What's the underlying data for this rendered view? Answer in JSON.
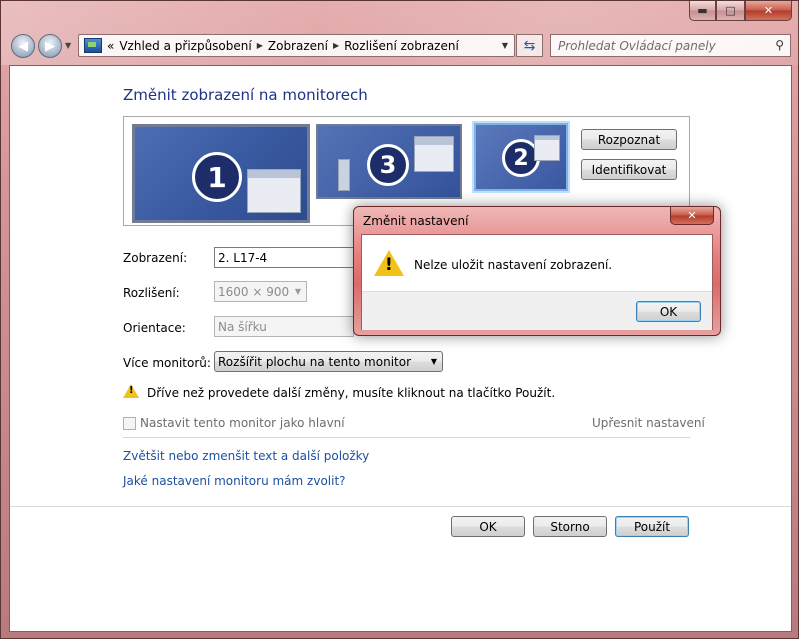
{
  "window": {
    "caption_buttons": {
      "minimize": "▬",
      "maximize": "□",
      "close": "✕"
    }
  },
  "nav": {
    "back_icon": "back-arrow-icon",
    "forward_icon": "forward-arrow-icon",
    "address": {
      "prefix": "«",
      "segments": [
        "Vzhled a přizpůsobení",
        "Zobrazení",
        "Rozlišení zobrazení"
      ]
    },
    "search_placeholder": "Prohledat Ovládací panely"
  },
  "page": {
    "title": "Změnit zobrazení na monitorech",
    "monitors": [
      {
        "number": "1"
      },
      {
        "number": "3"
      },
      {
        "number": "2"
      }
    ],
    "detect_label": "Rozpoznat",
    "identify_label": "Identifikovat",
    "display_label": "Zobrazení:",
    "display_value": "2. L17-4",
    "resolution_label": "Rozlišení:",
    "resolution_value": "1600 × 900",
    "orientation_label": "Orientace:",
    "orientation_value": "Na šířku",
    "multiple_label": "Více monitorů:",
    "multiple_value": "Rozšířit plochu na tento monitor",
    "warning_text": "Dříve než provedete další změny, musíte kliknout na tlačítko Použít.",
    "main_monitor_label": "Nastavit tento monitor jako hlavní",
    "advanced_link": "Upřesnit nastavení",
    "link_text_size": "Zvětšit nebo zmenšit text a další položky",
    "link_which_settings": "Jaké nastavení monitoru mám zvolit?",
    "ok_label": "OK",
    "cancel_label": "Storno",
    "apply_label": "Použít"
  },
  "dialog": {
    "title": "Změnit nastavení",
    "message": "Nelze uložit nastavení zobrazení.",
    "ok_label": "OK",
    "close_glyph": "✕"
  },
  "colors": {
    "title_blue": "#1e3287",
    "link_blue": "#1e50a2",
    "frame_tint": "#d59597",
    "monitor_blue": "#3a5aa1",
    "warning_yellow": "#f2c21b"
  }
}
